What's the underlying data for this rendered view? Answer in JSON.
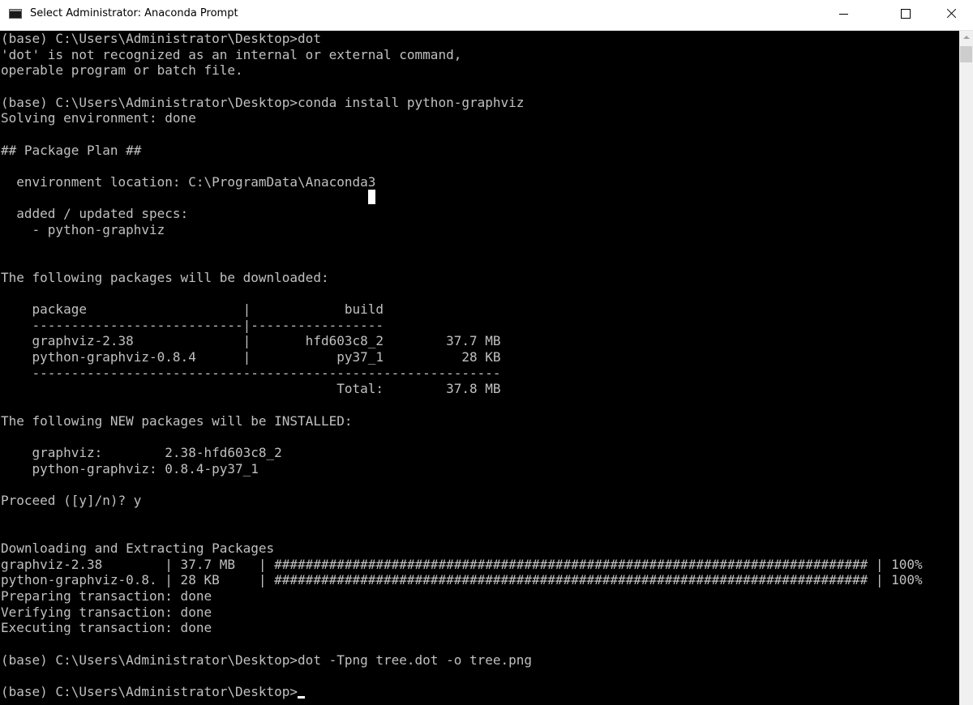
{
  "window": {
    "title": "Select Administrator: Anaconda Prompt",
    "icon": "console-icon",
    "controls": {
      "minimize": "minimize-icon",
      "maximize": "maximize-icon",
      "close": "close-icon"
    }
  },
  "console": {
    "text_color": "#c0c0c0",
    "background_color": "#000000",
    "lines": [
      "(base) C:\\Users\\Administrator\\Desktop>dot",
      "'dot' is not recognized as an internal or external command,",
      "operable program or batch file.",
      "",
      "(base) C:\\Users\\Administrator\\Desktop>conda install python-graphviz",
      "Solving environment: done",
      "",
      "## Package Plan ##",
      "",
      "  environment location: C:\\ProgramData\\Anaconda3",
      "",
      "  added / updated specs:",
      "    - python-graphviz",
      "",
      "",
      "The following packages will be downloaded:",
      "",
      "    package                    |            build",
      "    ---------------------------|-----------------",
      "    graphviz-2.38              |       hfd603c8_2        37.7 MB",
      "    python-graphviz-0.8.4      |           py37_1          28 KB",
      "    ------------------------------------------------------------",
      "                                           Total:        37.8 MB",
      "",
      "The following NEW packages will be INSTALLED:",
      "",
      "    graphviz:        2.38-hfd603c8_2",
      "    python-graphviz: 0.8.4-py37_1",
      "",
      "Proceed ([y]/n)? y",
      "",
      "",
      "Downloading and Extracting Packages",
      "graphviz-2.38        | 37.7 MB   | ############################################################################ | 100%",
      "python-graphviz-0.8. | 28 KB     | ############################################################################ | 100%",
      "Preparing transaction: done",
      "Verifying transaction: done",
      "Executing transaction: done",
      "",
      "(base) C:\\Users\\Administrator\\Desktop>dot -Tpng tree.dot -o tree.png",
      "",
      "(base) C:\\Users\\Administrator\\Desktop>"
    ]
  }
}
